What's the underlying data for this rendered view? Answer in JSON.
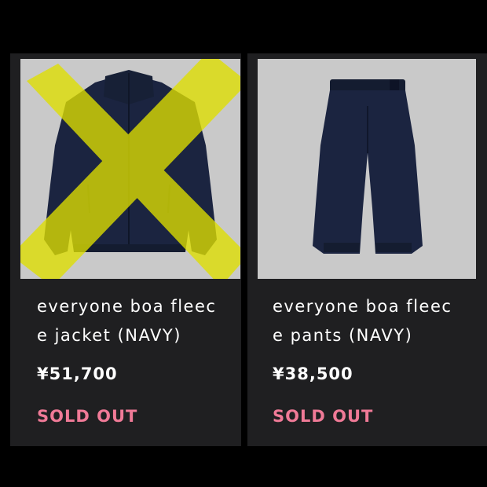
{
  "products": [
    {
      "title_line1": "everyone boa fleec",
      "title_line2": "e jacket (NAVY)",
      "price": "¥51,700",
      "status": "SOLD OUT",
      "image_icon": "fleece-jacket-image",
      "struck_out": true
    },
    {
      "title_line1": "everyone boa fleec",
      "title_line2": "e pants (NAVY)",
      "price": "¥38,500",
      "status": "SOLD OUT",
      "image_icon": "fleece-pants-image",
      "struck_out": false
    }
  ],
  "colors": {
    "background": "#000000",
    "card": "#1f1f21",
    "image_bg": "#c9c9c9",
    "navy": "#1b2440",
    "sold_out": "#f07a97",
    "strike_mark": "#dfe000"
  }
}
